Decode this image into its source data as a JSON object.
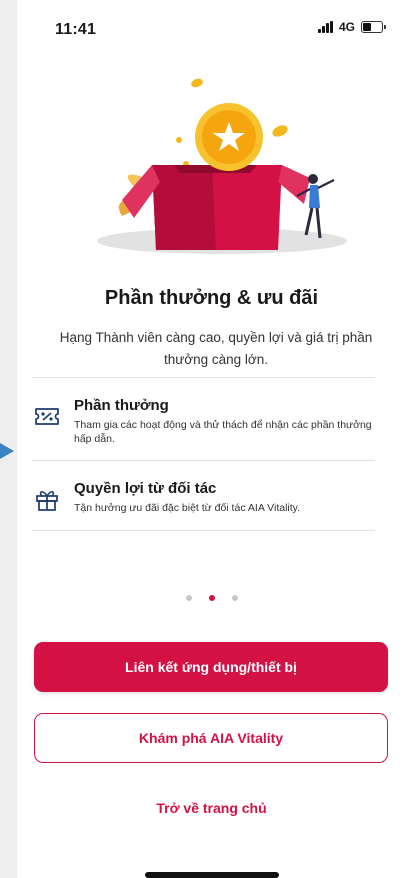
{
  "status": {
    "time": "11:41",
    "network": "4G"
  },
  "page": {
    "title": "Phần thưởng & ưu đãi",
    "subtitle": "Hạng Thành viên càng cao, quyền lợi và giá trị phần thưởng càng lớn."
  },
  "features": [
    {
      "icon": "ticket-percent-icon",
      "title": "Phần thưởng",
      "desc": "Tham gia các hoạt động và thử thách để nhận các phần thưởng hấp dẫn."
    },
    {
      "icon": "gift-icon",
      "title": "Quyền lợi từ đối tác",
      "desc": "Tận hưởng ưu đãi đặc biệt từ đối tác AIA Vitality."
    }
  ],
  "pager": {
    "total": 3,
    "active_index": 1
  },
  "buttons": {
    "link_app": "Liên kết ứng dụng/thiết bị",
    "explore": "Khám phá AIA Vitality",
    "home": "Trở về trang chủ"
  },
  "colors": {
    "accent": "#d31145",
    "divider": "#e3e3e3",
    "pointer": "#3b82c4"
  }
}
